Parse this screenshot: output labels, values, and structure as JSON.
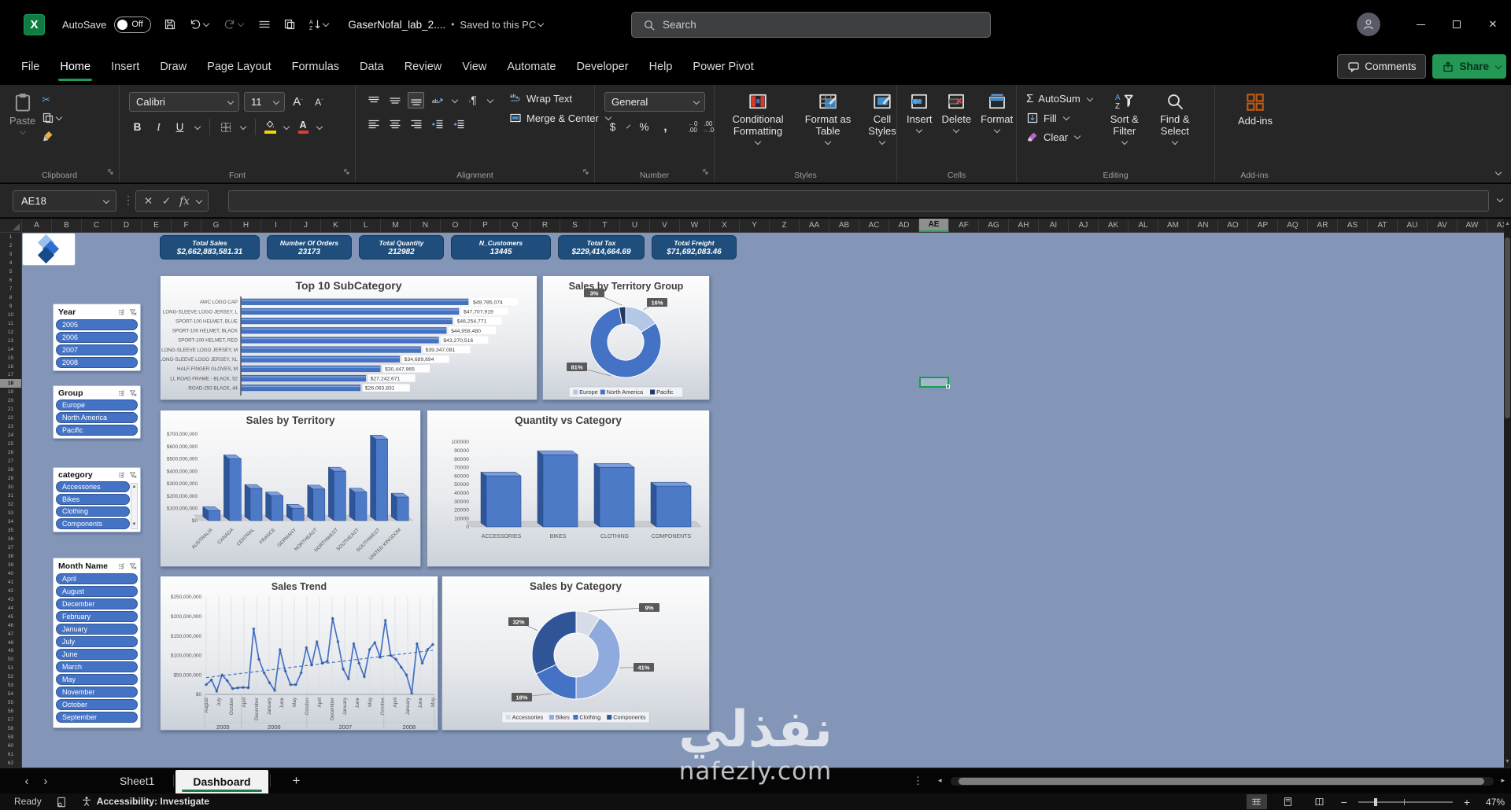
{
  "titlebar": {
    "autosave_label": "AutoSave",
    "autosave_state": "Off",
    "filename": "GaserNofal_lab_2....",
    "saved_status": "Saved to this PC",
    "search_placeholder": "Search"
  },
  "ribbon_tabs": [
    "File",
    "Home",
    "Insert",
    "Draw",
    "Page Layout",
    "Formulas",
    "Data",
    "Review",
    "View",
    "Automate",
    "Developer",
    "Help",
    "Power Pivot"
  ],
  "active_tab": "Home",
  "top_right": {
    "comments": "Comments",
    "share": "Share"
  },
  "ribbon": {
    "clipboard": {
      "label": "Clipboard",
      "paste": "Paste"
    },
    "font": {
      "label": "Font",
      "font_name": "Calibri",
      "font_size": "11",
      "bold": "B",
      "italic": "I",
      "underline": "U"
    },
    "alignment": {
      "label": "Alignment",
      "wrap_text": "Wrap Text",
      "merge_center": "Merge & Center",
      "ab": "ab"
    },
    "number": {
      "label": "Number",
      "format": "General",
      "currency": "$",
      "percent": "%",
      "comma": ","
    },
    "styles": {
      "label": "Styles",
      "conditional": "Conditional Formatting",
      "format_table": "Format as Table",
      "cell_styles": "Cell Styles"
    },
    "cells": {
      "label": "Cells",
      "insert": "Insert",
      "delete": "Delete",
      "format": "Format"
    },
    "editing": {
      "label": "Editing",
      "autosum": "AutoSum",
      "fill": "Fill",
      "clear": "Clear",
      "sort": "Sort & Filter",
      "find": "Find & Select",
      "sigma": "Σ"
    },
    "addins": {
      "label": "Add-ins",
      "button": "Add-ins"
    }
  },
  "formula_bar": {
    "name_box": "AE18",
    "fx": "fx"
  },
  "grid": {
    "columns": [
      "A",
      "B",
      "C",
      "D",
      "E",
      "F",
      "G",
      "H",
      "I",
      "J",
      "K",
      "L",
      "M",
      "N",
      "O",
      "P",
      "Q",
      "R",
      "S",
      "T",
      "U",
      "V",
      "W",
      "X",
      "Y",
      "Z",
      "AA",
      "AB",
      "AC",
      "AD",
      "AE",
      "AF",
      "AG",
      "AH",
      "AI",
      "AJ",
      "AK",
      "AL",
      "AM",
      "AN",
      "AO",
      "AP",
      "AQ",
      "AR",
      "AS",
      "AT",
      "AU",
      "AV",
      "AW",
      "AX"
    ],
    "row_count": 62,
    "selected_column": "AE",
    "selected_row": 18,
    "selected_cell": "AE18"
  },
  "dashboard": {
    "kpis": [
      {
        "label": "Total Sales",
        "value": "$2,662,883,581.31"
      },
      {
        "label": "Number Of Orders",
        "value": "23173"
      },
      {
        "label": "Total Quantity",
        "value": "212982"
      },
      {
        "label": "N_Customers",
        "value": "13445"
      },
      {
        "label": "Total Tax",
        "value": "$229,414,664.69"
      },
      {
        "label": "Total Freight",
        "value": "$71,692,083.46"
      }
    ],
    "slicers": [
      {
        "title": "Year",
        "items": [
          "2005",
          "2006",
          "2007",
          "2008"
        ],
        "scrollbar": false
      },
      {
        "title": "Group",
        "items": [
          "Europe",
          "North America",
          "Pacific"
        ],
        "scrollbar": false
      },
      {
        "title": "category",
        "items": [
          "Accessories",
          "Bikes",
          "Clothing",
          "Components"
        ],
        "scrollbar": true
      },
      {
        "title": "Month Name",
        "items": [
          "April",
          "August",
          "December",
          "February",
          "January",
          "July",
          "June",
          "March",
          "May",
          "November",
          "October",
          "September"
        ],
        "scrollbar": false
      }
    ]
  },
  "chart_data": [
    {
      "type": "bar",
      "orientation": "horizontal",
      "title": "Top 10 SubCategory",
      "categories": [
        "AWC LOGO CAP",
        "LONG-SLEEVE LOGO JERSEY, L",
        "SPORT-100 HELMET, BLUE",
        "SPORT-100 HELMET, BLACK",
        "SPORT-100 HELMET, RED",
        "LONG-SLEEVE LOGO JERSEY, M",
        "LONG-SLEEVE LOGO JERSEY, XL",
        "HALF-FINGER GLOVES, M",
        "LL ROAD FRAME - BLACK, 52",
        "ROAD-250 BLACK, 44"
      ],
      "values": [
        49785074,
        47707919,
        46254771,
        44958480,
        43270516,
        39347081,
        34689694,
        30447965,
        27242671,
        26063831
      ],
      "data_labels": [
        "$49,785,074",
        "$47,707,919",
        "$46,254,771",
        "$44,958,480",
        "$43,270,516",
        "$39,347,081",
        "$34,689,694",
        "$30,447,965",
        "$27,242,671",
        "$26,063,831"
      ],
      "bar_color": "#4472c4"
    },
    {
      "type": "pie",
      "subtype": "donut",
      "title": "Sales by Territory Group",
      "categories": [
        "Europe",
        "North America",
        "Pacific"
      ],
      "values": [
        16,
        81,
        3
      ],
      "labels": [
        "16%",
        "81%",
        "3%"
      ],
      "colors": [
        "#b4c7e7",
        "#4472c4",
        "#1f3864"
      ],
      "legend_position": "bottom"
    },
    {
      "type": "bar",
      "subtype": "3d-column",
      "title": "Sales by Territory",
      "categories": [
        "AUSTRALIA",
        "CANADA",
        "CENTRAL",
        "FRANCE",
        "GERMANY",
        "NORTHEAST",
        "NORTHWEST",
        "SOUTHEAST",
        "SOUTHWEST",
        "UNITED KINGDOM"
      ],
      "values": [
        80000000,
        500000000,
        260000000,
        200000000,
        100000000,
        255000000,
        400000000,
        230000000,
        660000000,
        190000000
      ],
      "ylim": [
        0,
        700000000
      ],
      "y_ticks": [
        "$0",
        "$100,000,000",
        "$200,000,000",
        "$300,000,000",
        "$400,000,000",
        "$500,000,000",
        "$600,000,000",
        "$700,000,000"
      ]
    },
    {
      "type": "bar",
      "subtype": "3d-column",
      "title": "Quantity vs Category",
      "categories": [
        "ACCESSORIES",
        "BIKES",
        "CLOTHING",
        "COMPONENTS"
      ],
      "values": [
        60000,
        85000,
        70000,
        48000
      ],
      "ylim": [
        0,
        100000
      ],
      "y_ticks": [
        "0",
        "10000",
        "20000",
        "30000",
        "40000",
        "50000",
        "60000",
        "70000",
        "80000",
        "90000",
        "100000"
      ]
    },
    {
      "type": "line",
      "title": "Sales Trend",
      "values_millions": [
        25,
        37,
        8,
        50,
        35,
        15,
        17,
        18,
        17,
        168,
        90,
        55,
        30,
        10,
        115,
        60,
        25,
        25,
        55,
        120,
        75,
        135,
        80,
        85,
        195,
        135,
        65,
        40,
        130,
        80,
        45,
        115,
        133,
        95,
        190,
        100,
        90,
        70,
        50,
        3,
        130,
        80,
        115,
        128
      ],
      "x_tick_labels": [
        "August",
        "July",
        "October",
        "April",
        "December",
        "January",
        "June",
        "May",
        "October",
        "April",
        "December",
        "January",
        "June",
        "May",
        "October",
        "April",
        "January",
        "June",
        "May"
      ],
      "year_groups": [
        "2005",
        "2006",
        "2007",
        "2008"
      ],
      "year_bounds": [
        0,
        0.16,
        0.445,
        0.78,
        1
      ],
      "y_ticks": [
        "$0",
        "$50,000,000",
        "$100,000,000",
        "$150,000,000",
        "$200,000,000",
        "$250,000,000"
      ],
      "ylim_millions": [
        0,
        250
      ],
      "trendline_millions": [
        43,
        113
      ],
      "line_color": "#4472c4"
    },
    {
      "type": "pie",
      "subtype": "donut",
      "title": "Sales by Category",
      "categories": [
        "Accessories",
        "Bikes",
        "Clothing",
        "Components"
      ],
      "values": [
        9,
        41,
        18,
        32
      ],
      "labels": [
        "9%",
        "41%",
        "18%",
        "32%"
      ],
      "colors": [
        "#d6dce8",
        "#8faadc",
        "#4472c4",
        "#2f5597"
      ],
      "legend_position": "bottom"
    }
  ],
  "sheet_tabs": {
    "tabs": [
      "Sheet1",
      "Dashboard"
    ],
    "active": "Dashboard"
  },
  "status_bar": {
    "ready": "Ready",
    "accessibility": "Accessibility: Investigate",
    "zoom": "47%"
  },
  "watermark": {
    "line1": "نفذلي",
    "line2": "nafezly.com"
  },
  "icons": {
    "search-icon": "magnifier",
    "save-icon": "floppy",
    "undo-icon": "arrow-ccw",
    "redo-icon": "arrow-cw",
    "menu-icon": "three-lines",
    "copy-icon": "two-pages",
    "sort-az-icon": "az-down-arrow",
    "more-commands-icon": "chevron-down",
    "user-avatar": "person",
    "minimize-icon": "line",
    "maximize-icon": "square",
    "close-icon": "x",
    "comments-icon": "speech-bubble",
    "share-icon": "box-up-arrow",
    "cut-icon": "scissors",
    "paste-icon": "clipboard",
    "format-painter-icon": "brush",
    "borders-icon": "grid",
    "fill-color-icon": "bucket-yellow-bar",
    "font-color-icon": "a-red-bar",
    "wrap-text-icon": "ab-wrap-arrow",
    "merge-center-icon": "merged-cells",
    "orientation-icon": "ab-diagonal",
    "paragraph-icon": "pilcrow",
    "autosum-icon": "sigma",
    "fill-icon": "boxed-down-arrow",
    "clear-icon": "eraser-diamond",
    "sort-filter-icon": "az-funnel",
    "find-icon": "magnifier",
    "addins-icon": "orange-grid",
    "conditional-formatting-icon": "red-blue-cells",
    "format-table-icon": "table-brush",
    "cell-styles-icon": "cells-brush",
    "insert-icon": "insert-cells",
    "delete-icon": "delete-cells-x",
    "format-icon": "format-cells",
    "dialog-launcher-icon": "corner-arrow",
    "macro-icon": "sheet-record",
    "accessibility-icon": "person-circle",
    "view-normal-icon": "grid",
    "view-page-layout-icon": "page",
    "view-page-break-icon": "page-dashed",
    "zoom-out-icon": "minus",
    "zoom-in-icon": "plus",
    "multi-select-icon": "list-checks",
    "clear-filter-icon": "funnel-x",
    "scroll-up-icon": "triangle-up",
    "scroll-down-icon": "triangle-down",
    "prev-sheet-icon": "angle-left",
    "next-sheet-icon": "angle-right",
    "new-sheet-icon": "plus",
    "kebab-icon": "vertical-dots"
  }
}
